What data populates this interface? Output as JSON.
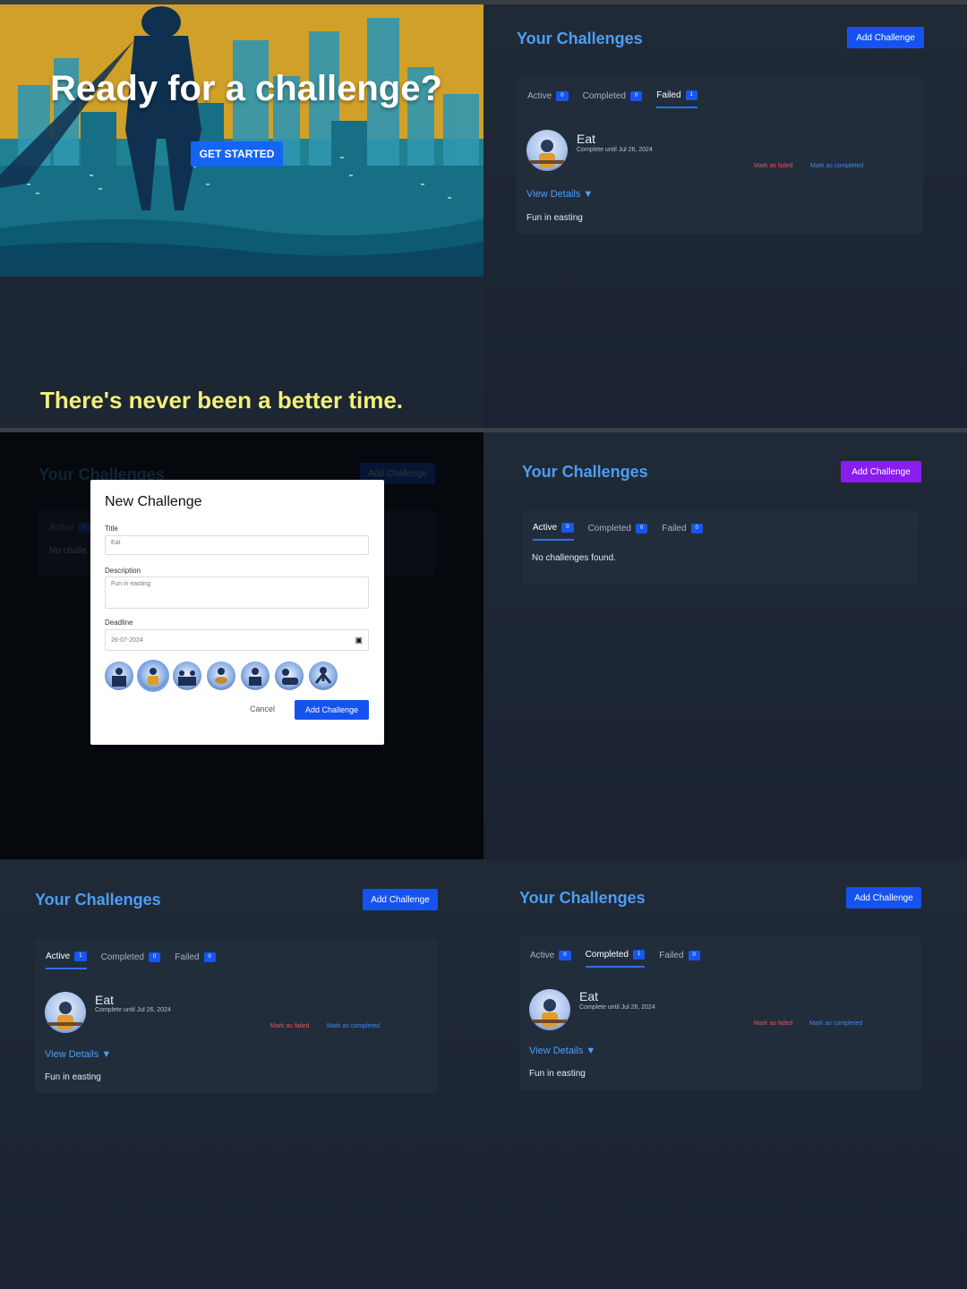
{
  "hero": {
    "title": "Ready for a challenge?",
    "cta_label": "GET STARTED",
    "tagline": "There's never been a better time."
  },
  "challenges": {
    "page_title": "Your Challenges",
    "add_label": "Add Challenge",
    "tabs": [
      {
        "label": "Active"
      },
      {
        "label": "Completed"
      },
      {
        "label": "Failed"
      }
    ],
    "empty_text": "No challenges found.",
    "item": {
      "name": "Eat",
      "until": "Complete until Jul 26, 2024",
      "mark_failed": "Mark as failed",
      "mark_completed": "Mark as completed",
      "view_details": "View Details",
      "view_details_arrow": "▼",
      "description": "Fun in easting"
    }
  },
  "screens": {
    "s2": {
      "active_tab": "Failed",
      "counts": [
        "0",
        "0",
        "1"
      ]
    },
    "s3_bg": {
      "active_tab": "Active",
      "active_label_short": "Active",
      "counts": [
        "0"
      ],
      "empty_partial": "No challe"
    },
    "s4": {
      "active_tab": "Active",
      "counts": [
        "0",
        "0",
        "0"
      ]
    },
    "s5": {
      "active_tab": "Active",
      "counts": [
        "1",
        "0",
        "0"
      ]
    },
    "s6": {
      "active_tab": "Completed",
      "counts": [
        "0",
        "1",
        "0"
      ]
    }
  },
  "modal": {
    "title": "New Challenge",
    "title_label": "Title",
    "title_value": "Eat",
    "description_label": "Description",
    "description_value": "Fun in easting",
    "deadline_label": "Deadline",
    "deadline_value": "26-07-2024",
    "icon_names": [
      "piano-icon",
      "cooking-icon",
      "group-icon",
      "guitar-icon",
      "reading-icon",
      "rest-icon",
      "exercise-icon"
    ],
    "cancel_label": "Cancel",
    "submit_label": "Add Challenge"
  },
  "colors": {
    "accent_blue": "#1552f0",
    "accent_purple": "#8a1cf0",
    "title_blue": "#4c9ef5",
    "failed_red": "#e2545a",
    "tagline_yellow": "#f2f07a"
  }
}
